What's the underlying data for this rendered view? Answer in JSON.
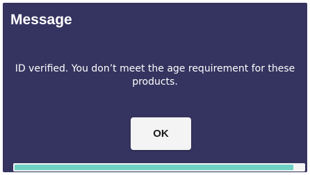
{
  "dialog": {
    "title": "Message",
    "message": "ID verified. You don’t meet the age requirement for these products.",
    "ok_label": "OK",
    "progress": 0.965
  },
  "colors": {
    "background": "#35335f",
    "progress_fill": "#6fd1c4",
    "button": "#f4f4f4"
  }
}
